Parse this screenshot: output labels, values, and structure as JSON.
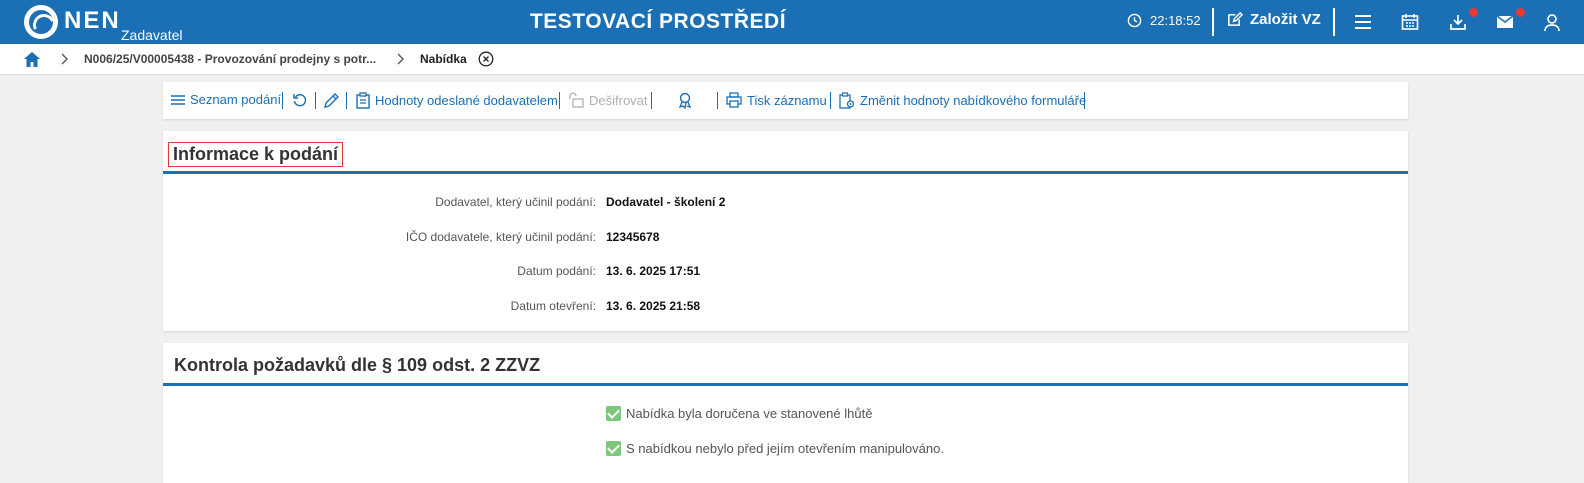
{
  "header": {
    "logo_text": "NEN",
    "logo_role": "Zadavatel",
    "env_title": "TESTOVACÍ PROSTŘEDÍ",
    "clock": "22:18:52",
    "create_label": "Založit VZ"
  },
  "breadcrumb": {
    "items": [
      "N006/25/V00005438 - Provozování prodejny s potr...",
      "Nabídka"
    ]
  },
  "toolbar": {
    "list_label": "Seznam podání",
    "sent_values_label": "Hodnoty odeslané dodavatelem",
    "decrypt_label": "Dešifrovat",
    "print_label": "Tisk záznamu",
    "change_form_label": "Změnit hodnoty nabídkového formuláře"
  },
  "info_panel": {
    "title": "Informace k podání",
    "rows": [
      {
        "label": "Dodavatel, který učinil podání:",
        "value": "Dodavatel - školení 2"
      },
      {
        "label": "IČO dodavatele, který učinil podání:",
        "value": "12345678"
      },
      {
        "label": "Datum podání:",
        "value": "13. 6. 2025 17:51"
      },
      {
        "label": "Datum otevření:",
        "value": "13. 6. 2025 21:58"
      }
    ]
  },
  "check_panel": {
    "title": "Kontrola požadavků dle § 109 odst. 2 ZZVZ",
    "items": [
      {
        "label": "Nabídka byla doručena ve stanovené lhůtě",
        "checked": true
      },
      {
        "label": "S nabídkou nebylo před jejím otevřením manipulováno.",
        "checked": true
      }
    ]
  },
  "colors": {
    "brand": "#1a6fb5",
    "notification": "#e53935",
    "check": "#7dc77d"
  }
}
